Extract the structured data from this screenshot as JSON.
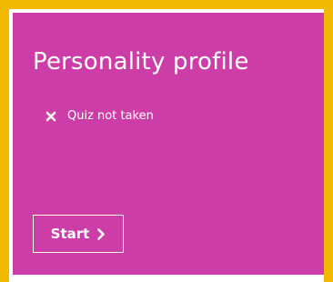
{
  "colors": {
    "frame_accent": "#f2b800",
    "card_background": "#cc3da8",
    "text": "#ffffff"
  },
  "card": {
    "title": "Personality profile",
    "status": {
      "icon": "close-icon",
      "label": "Quiz not taken"
    },
    "start_button": {
      "label": "Start",
      "icon": "chevron-right-icon"
    }
  }
}
